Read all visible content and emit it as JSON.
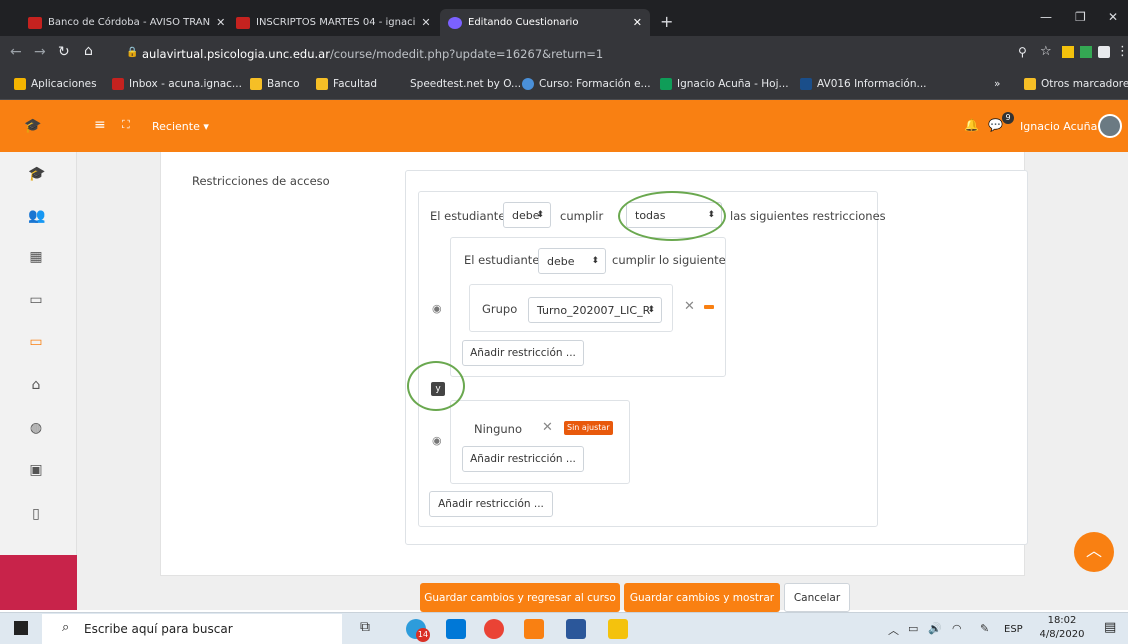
{
  "browser": {
    "tabs": [
      {
        "label": "Banco de Córdoba - AVISO TRAN",
        "color": "#c5221f"
      },
      {
        "label": "INSCRIPTOS MARTES 04 - ignaci",
        "color": "#c5221f"
      },
      {
        "label": "Editando Cuestionario",
        "color": "#7b61ff"
      }
    ],
    "url_domain": "aulavirtual.psicologia.unc.edu.ar",
    "url_path": "/course/modedit.php?update=16267&return=1",
    "bookmarks": [
      {
        "label": "Aplicaciones",
        "icon": "apps-grid-icon"
      },
      {
        "label": "Inbox - acuna.ignac...",
        "icon": "gmail-icon"
      },
      {
        "label": "Banco",
        "icon": "folder-icon"
      },
      {
        "label": "Facultad",
        "icon": "folder-icon"
      },
      {
        "label": "Speedtest.net by O...",
        "icon": "speedtest-icon"
      },
      {
        "label": "Curso: Formación e...",
        "icon": "course-icon"
      },
      {
        "label": "Ignacio Acuña - Hoj...",
        "icon": "sheets-icon"
      },
      {
        "label": "AV016 Información...",
        "icon": "unc-icon"
      }
    ],
    "more_bookmarks": "»",
    "other_bookmarks": "Otros marcadores"
  },
  "moodle": {
    "recent": "Reciente ▾",
    "user_name": "Ignacio Acuña",
    "msg_count": "9"
  },
  "form": {
    "section_label": "Restricciones de acceso",
    "row1_prefix": "El estudiante",
    "row1_select": "debe",
    "row1_mid": "cumplir",
    "row1_select2": "todas",
    "row1_suffix": "las siguientes restricciones",
    "row2_prefix": "El estudiante",
    "row2_select": "debe",
    "row2_suffix": "cumplir lo siguiente",
    "group_label": "Grupo",
    "group_select": "Turno_202007_LIC_R",
    "add_restriction": "Añadir restricción ...",
    "and_badge": "y",
    "none_label": "Ninguno",
    "unset_badge": "Sin ajustar"
  },
  "actions": {
    "save_return": "Guardar cambios y regresar al curso",
    "save_show": "Guardar cambios y mostrar",
    "cancel": "Cancelar"
  },
  "taskbar": {
    "search_placeholder": "Escribe aquí para buscar",
    "badge": "14",
    "lang": "ESP",
    "time": "18:02",
    "date": "4/8/2020"
  },
  "colors": {
    "moodle_orange": "#f98012",
    "highlight_circle": "#6aa84f"
  }
}
